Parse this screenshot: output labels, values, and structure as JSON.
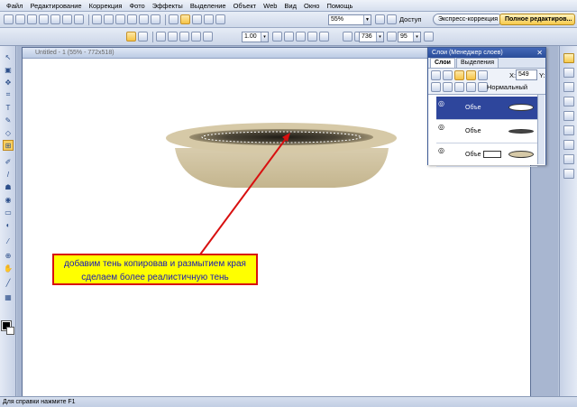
{
  "menu": {
    "items": [
      "Файл",
      "Редактирование",
      "Коррекция",
      "Фото",
      "Эффекты",
      "Выделение",
      "Объект",
      "Web",
      "Вид",
      "Окно",
      "Помощь"
    ]
  },
  "toolbar": {
    "zoom_value": "55%",
    "access_label": "Доступ",
    "express_label": "Экспресс-коррекция",
    "full_edit_label": "Полное редактиров..."
  },
  "props": {
    "angle_value": "1.00",
    "width_value": "736",
    "height_value": "95"
  },
  "document": {
    "title": "Untitled - 1 (55% - 772x518)"
  },
  "layers_panel": {
    "title": "Слои (Менеджер слоев)",
    "tabs": [
      "Слои",
      "Выделения"
    ],
    "x_label": "X:",
    "x_value": "549",
    "y_label": "Y:",
    "blend_mode": "Нормальный",
    "layers": [
      {
        "name": "Объе",
        "selected": true
      },
      {
        "name": "Объе",
        "selected": false
      },
      {
        "name": "Объе",
        "selected": false
      }
    ]
  },
  "annotation": {
    "text": "добавим тень копировав и размытием края сделаем более реалистичную тень"
  },
  "status": {
    "text": "Для справки нажмите F1"
  },
  "colors": {
    "annotation_bg": "#ffff00",
    "annotation_border": "#d81010",
    "annotation_text": "#1a1ab4",
    "arrow": "#d81010",
    "selected_layer": "#2e469c"
  }
}
